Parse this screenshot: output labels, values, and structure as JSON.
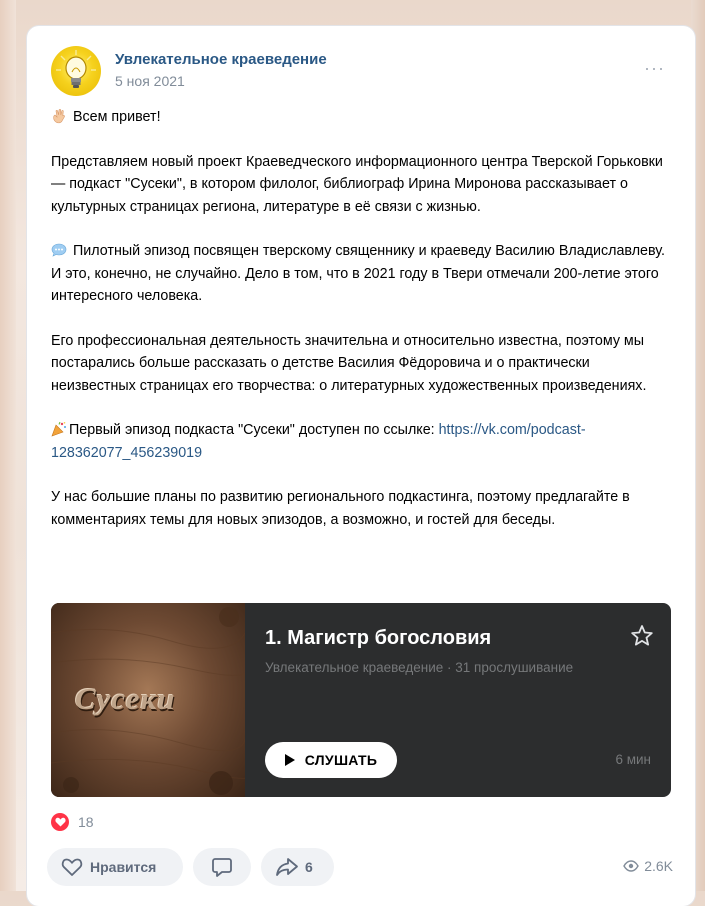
{
  "post": {
    "author": "Увлекательное краеведение",
    "date": "5 ноя 2021",
    "more": "···",
    "greeting": "Всем привет!",
    "para1": "Представляем новый проект Краеведческого информационного центра Тверской Горьковки — подкаст \"Сусеки\", в котором филолог, библиограф Ирина Миронова рассказывает о культурных страницах региона, литературе в её связи с жизнью.",
    "para2": "Пилотный эпизод посвящен тверскому священнику и краеведу Василию Владиславлеву. И это, конечно, не случайно. Дело в том, что в 2021 году в Твери отмечали 200-летие этого интересного человека.",
    "para3": "Его профессиональная деятельность значительна и относительно известна, поэтому мы постарались больше рассказать о детстве Василия Фёдоровича и о практически неизвестных страницах его творчества: о литературных художественных произведениях.",
    "para4_text": "Первый эпизод подкаста \"Сусеки\" доступен по ссылке: ",
    "para4_link": "https://vk.com/podcast-128362077_456239019",
    "para5": "У нас большие планы по развитию регионального подкастинга, поэтому предлагайте в комментариях темы для новых эпизодов, а возможно, и гостей для беседы."
  },
  "podcast": {
    "cover_word": "Сусеки",
    "title": "1. Магистр богословия",
    "meta": "Увлекательное краеведение · 31 прослушивание",
    "listen_label": "СЛУШАТЬ",
    "duration": "6 мин"
  },
  "reactions": {
    "count": "18"
  },
  "actions": {
    "like_label": "Нравится",
    "share_count": "6",
    "views": "2.6K"
  },
  "colors": {
    "link": "#2a5885",
    "reaction": "#ff3347",
    "player_bg": "#2c2d2e"
  },
  "icons": [
    "lightbulb-icon",
    "wave-hand-icon",
    "speech-bubble-icon",
    "party-popper-icon",
    "star-icon",
    "play-icon",
    "heart-icon",
    "comment-icon",
    "share-icon",
    "eye-icon"
  ]
}
